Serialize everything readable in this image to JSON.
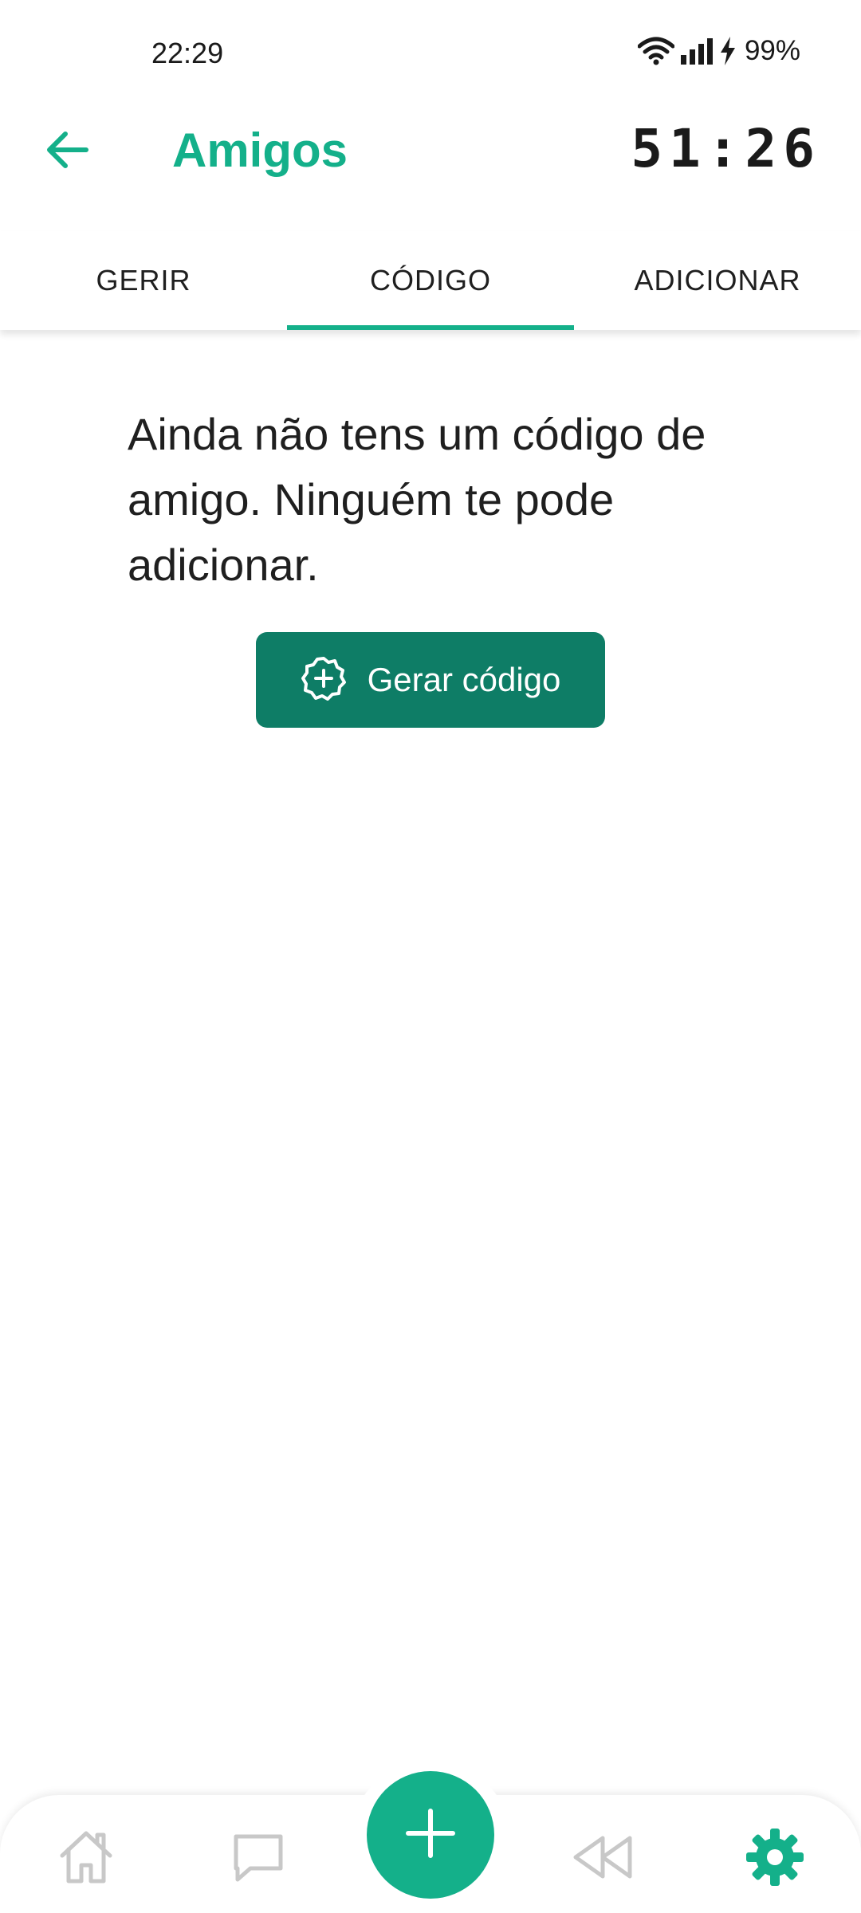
{
  "status_bar": {
    "time": "22:29",
    "battery": "99%",
    "icons": [
      "wifi-icon",
      "signal-icon",
      "charging-icon"
    ]
  },
  "app_bar": {
    "title": "Amigos",
    "timer": "51:26",
    "back_icon": "arrow-left-icon"
  },
  "tabs": [
    {
      "label": "GERIR",
      "active": false
    },
    {
      "label": "CÓDIGO",
      "active": true
    },
    {
      "label": "ADICIONAR",
      "active": false
    }
  ],
  "content": {
    "message": "Ainda não tens um código de amigo. Ninguém te pode adicionar.",
    "button_label": "Gerar código",
    "button_icon": "badge-plus-icon"
  },
  "bottom_nav": {
    "items": [
      "home-icon",
      "chat-icon",
      "add-icon",
      "rewind-icon",
      "settings-icon"
    ],
    "active": "settings-icon"
  },
  "colors": {
    "accent": "#14b08a",
    "button": "#0e7d66",
    "inactive_icon": "#c8c8c8"
  }
}
